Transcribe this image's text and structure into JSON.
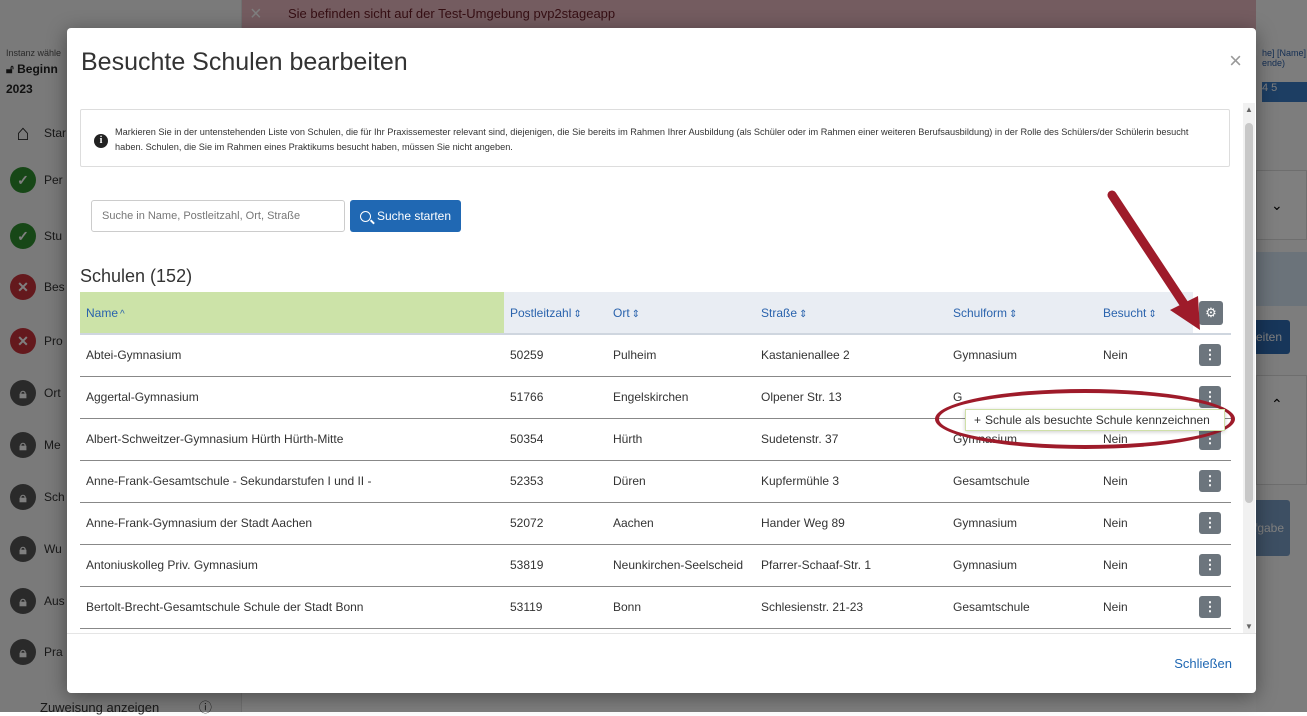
{
  "banner": {
    "close_glyph": "×",
    "text": "Sie befinden sicht auf der Test-Umgebung pvp2stageapp"
  },
  "sidebar": {
    "instance_label": "Instanz wähle",
    "instance_value": "Beginn",
    "year": "2023",
    "items": [
      {
        "label": "Star",
        "icon": "home-icon",
        "status": "home"
      },
      {
        "label": "Per",
        "icon": "check-icon",
        "status": "ok"
      },
      {
        "label": "Stu",
        "icon": "check-icon",
        "status": "ok"
      },
      {
        "label": "Bes",
        "icon": "error-icon",
        "status": "error"
      },
      {
        "label": "Pro",
        "icon": "error-icon",
        "status": "error"
      },
      {
        "label": "Ort",
        "icon": "lock-icon",
        "status": "locked"
      },
      {
        "label": "Me",
        "icon": "lock-icon",
        "status": "locked"
      },
      {
        "label": "Sch",
        "icon": "lock-icon",
        "status": "locked"
      },
      {
        "label": "Wu",
        "icon": "lock-icon",
        "status": "locked"
      },
      {
        "label": "Aus",
        "icon": "lock-icon",
        "status": "locked"
      },
      {
        "label": "Pra",
        "icon": "lock-icon",
        "status": "locked"
      }
    ],
    "bottom_label": "Zuweisung anzeigen"
  },
  "right_panel": {
    "user": "he] [Name]",
    "user_sub": "ende)",
    "steps": "4  5",
    "button1": "eiten",
    "button2": "fgabe"
  },
  "modal": {
    "title": "Besuchte Schulen bearbeiten",
    "close_glyph": "×",
    "info_text": "Markieren Sie in der untenstehenden Liste von Schulen, die für Ihr Praxissemester relevant sind, diejenigen, die Sie bereits im Rahmen Ihrer Ausbildung (als Schüler oder im Rahmen einer weiteren Berufsausbildung) in der Rolle des Schülers/der Schülerin besucht haben. Schulen, die Sie im Rahmen eines Praktikums besucht haben, müssen Sie nicht angeben.",
    "search": {
      "placeholder": "Suche in Name, Postleitzahl, Ort, Straße",
      "value": "",
      "button_label": "Suche starten"
    },
    "list_title": "Schulen (152)",
    "columns": [
      "Name",
      "Postleitzahl",
      "Ort",
      "Straße",
      "Schulform",
      "Besucht"
    ],
    "rows": [
      {
        "name": "Abtei-Gymnasium",
        "plz": "50259",
        "ort": "Pulheim",
        "strasse": "Kastanienallee 2",
        "schulform": "Gymnasium",
        "besucht": "Nein"
      },
      {
        "name": "Aggertal-Gymnasium",
        "plz": "51766",
        "ort": "Engelskirchen",
        "strasse": "Olpener Str. 13",
        "schulform": "G",
        "besucht": ""
      },
      {
        "name": "Albert-Schweitzer-Gymnasium Hürth Hürth-Mitte",
        "plz": "50354",
        "ort": "Hürth",
        "strasse": "Sudetenstr. 37",
        "schulform": "Gymnasium",
        "besucht": "Nein"
      },
      {
        "name": "Anne-Frank-Gesamtschule - Sekundarstufen I und II -",
        "plz": "52353",
        "ort": "Düren",
        "strasse": "Kupfermühle 3",
        "schulform": "Gesamtschule",
        "besucht": "Nein"
      },
      {
        "name": "Anne-Frank-Gymnasium der Stadt Aachen",
        "plz": "52072",
        "ort": "Aachen",
        "strasse": "Hander Weg 89",
        "schulform": "Gymnasium",
        "besucht": "Nein"
      },
      {
        "name": "Antoniuskolleg Priv. Gymnasium",
        "plz": "53819",
        "ort": "Neunkirchen-Seelscheid",
        "strasse": "Pfarrer-Schaaf-Str. 1",
        "schulform": "Gymnasium",
        "besucht": "Nein"
      },
      {
        "name": "Bertolt-Brecht-Gesamtschule Schule der Stadt Bonn",
        "plz": "53119",
        "ort": "Bonn",
        "strasse": "Schlesienstr. 21-23",
        "schulform": "Gesamtschule",
        "besucht": "Nein"
      }
    ],
    "context_menu": {
      "icon_glyph": "+",
      "label": "Schule als besuchte Schule kennzeichnen"
    },
    "footer_close": "Schließen"
  },
  "annotation_color": "#9e1b2a",
  "accent_color": "#2068b3",
  "sorted_header_color": "#cce3a8"
}
